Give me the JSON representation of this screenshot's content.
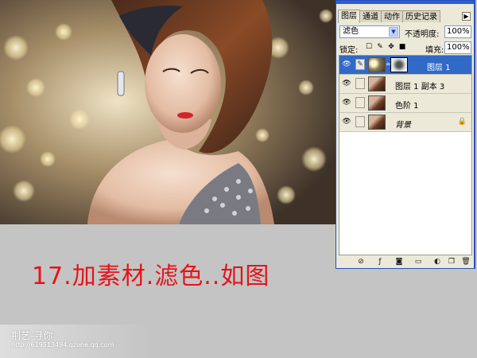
{
  "caption": "17.加素材.滤色..如图",
  "watermark": {
    "title": "荆艺-寻你",
    "url": "http://619513494.qzone.qq.com"
  },
  "palette": {
    "tabs": [
      {
        "label": "图层",
        "active": true
      },
      {
        "label": "通道",
        "active": false
      },
      {
        "label": "动作",
        "active": false
      },
      {
        "label": "历史记录",
        "active": false
      }
    ],
    "blend_mode": "滤色",
    "opacity_label": "不透明度:",
    "opacity_value": "100%",
    "lock_label": "锁定:",
    "fill_label": "填充:",
    "fill_value": "100%",
    "layers": [
      {
        "name": "图层 1",
        "selected": true,
        "has_mask": true
      },
      {
        "name": "图层 1 副本 3",
        "selected": false,
        "has_mask": false
      },
      {
        "name": "色阶 1",
        "selected": false,
        "has_mask": false
      },
      {
        "name": "背景",
        "selected": false,
        "has_mask": false,
        "locked": true
      }
    ],
    "bottom_icons": [
      "link-icon",
      "layer-style-icon",
      "mask-icon",
      "folder-icon",
      "adjustment-icon",
      "new-layer-icon",
      "trash-icon"
    ]
  },
  "colors": {
    "caption": "#e4141a",
    "palette_border": "#2a4fb5",
    "selected_row": "#3169c6",
    "background": "#c4c4c4"
  }
}
